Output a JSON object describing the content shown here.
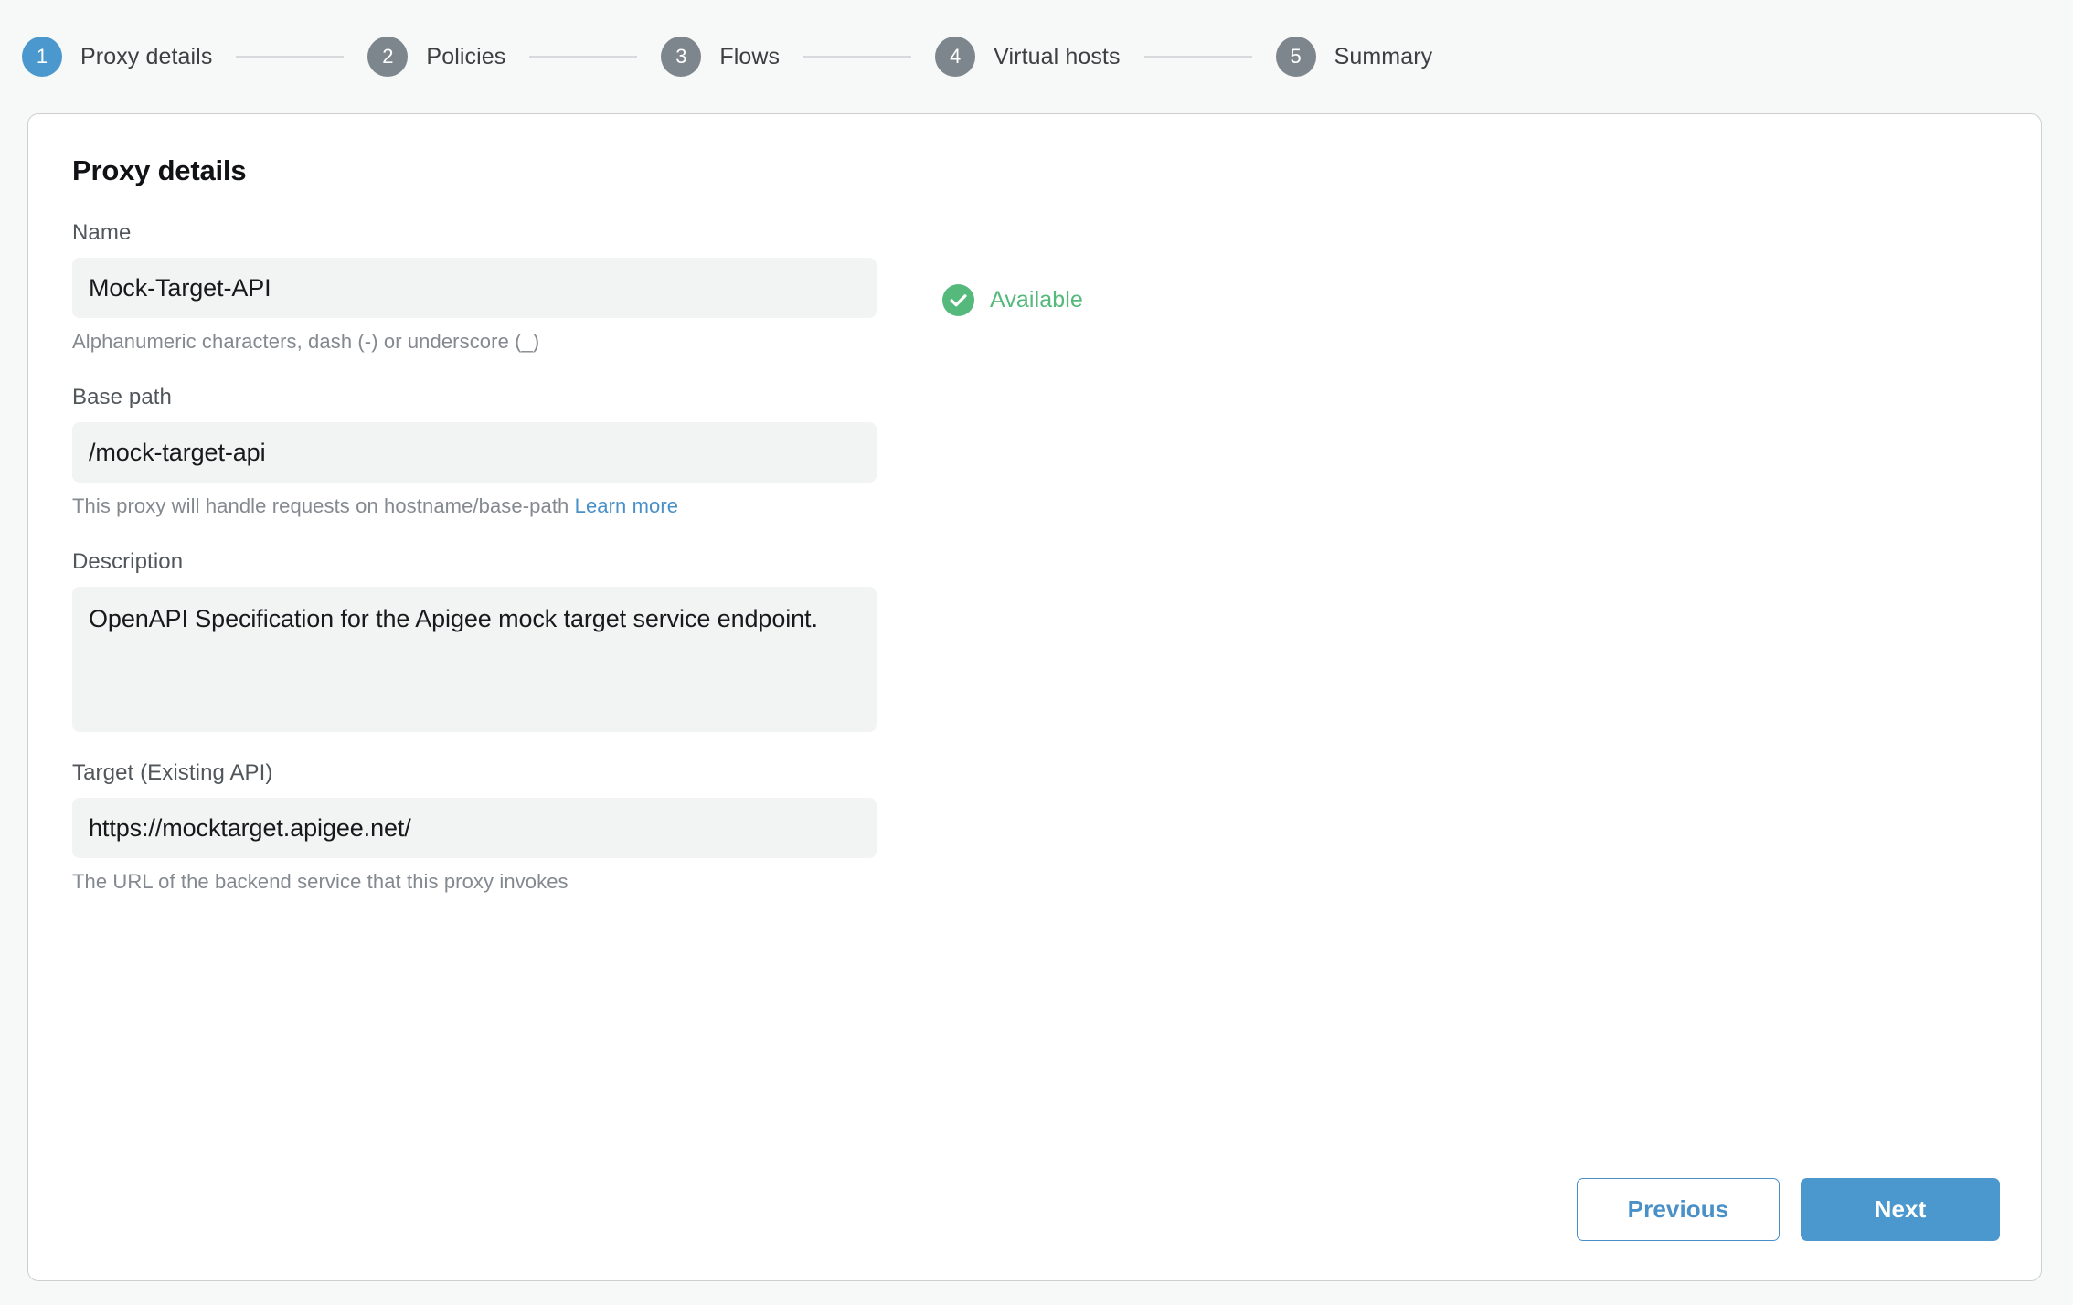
{
  "stepper": {
    "steps": [
      {
        "number": "1",
        "label": "Proxy details",
        "state": "active"
      },
      {
        "number": "2",
        "label": "Policies",
        "state": "inactive"
      },
      {
        "number": "3",
        "label": "Flows",
        "state": "inactive"
      },
      {
        "number": "4",
        "label": "Virtual hosts",
        "state": "inactive"
      },
      {
        "number": "5",
        "label": "Summary",
        "state": "inactive"
      }
    ]
  },
  "card": {
    "title": "Proxy details",
    "fields": {
      "name": {
        "label": "Name",
        "value": "Mock-Target-API",
        "hint": "Alphanumeric characters, dash (-) or underscore (_)"
      },
      "base_path": {
        "label": "Base path",
        "value": "/mock-target-api",
        "hint": "This proxy will handle requests on hostname/base-path",
        "hint_link": "Learn more"
      },
      "description": {
        "label": "Description",
        "value": "OpenAPI Specification for the Apigee mock target service endpoint."
      },
      "target": {
        "label": "Target (Existing API)",
        "value": "https://mocktarget.apigee.net/",
        "hint": "The URL of the backend service that this proxy invokes"
      }
    },
    "availability": {
      "icon": "check-circle-icon",
      "text": "Available"
    },
    "footer": {
      "previous_label": "Previous",
      "next_label": "Next"
    }
  },
  "colors": {
    "accent_blue": "#4a98ce",
    "link_blue": "#4a90c8",
    "success_green": "#55b97c",
    "step_inactive_gray": "#7e868d",
    "page_background": "#f7f8f8",
    "input_background": "#f2f3f3"
  }
}
